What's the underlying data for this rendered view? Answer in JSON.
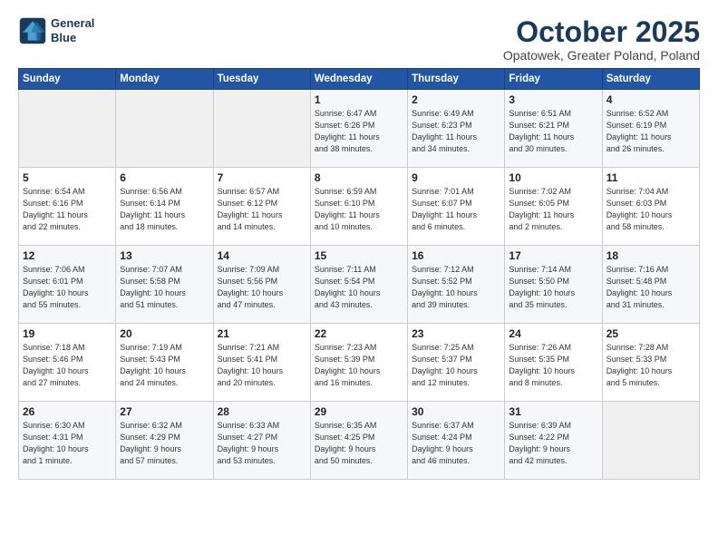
{
  "header": {
    "logo_line1": "General",
    "logo_line2": "Blue",
    "month": "October 2025",
    "location": "Opatowek, Greater Poland, Poland"
  },
  "days_of_week": [
    "Sunday",
    "Monday",
    "Tuesday",
    "Wednesday",
    "Thursday",
    "Friday",
    "Saturday"
  ],
  "weeks": [
    [
      {
        "day": "",
        "info": ""
      },
      {
        "day": "",
        "info": ""
      },
      {
        "day": "",
        "info": ""
      },
      {
        "day": "1",
        "info": "Sunrise: 6:47 AM\nSunset: 6:26 PM\nDaylight: 11 hours\nand 38 minutes."
      },
      {
        "day": "2",
        "info": "Sunrise: 6:49 AM\nSunset: 6:23 PM\nDaylight: 11 hours\nand 34 minutes."
      },
      {
        "day": "3",
        "info": "Sunrise: 6:51 AM\nSunset: 6:21 PM\nDaylight: 11 hours\nand 30 minutes."
      },
      {
        "day": "4",
        "info": "Sunrise: 6:52 AM\nSunset: 6:19 PM\nDaylight: 11 hours\nand 26 minutes."
      }
    ],
    [
      {
        "day": "5",
        "info": "Sunrise: 6:54 AM\nSunset: 6:16 PM\nDaylight: 11 hours\nand 22 minutes."
      },
      {
        "day": "6",
        "info": "Sunrise: 6:56 AM\nSunset: 6:14 PM\nDaylight: 11 hours\nand 18 minutes."
      },
      {
        "day": "7",
        "info": "Sunrise: 6:57 AM\nSunset: 6:12 PM\nDaylight: 11 hours\nand 14 minutes."
      },
      {
        "day": "8",
        "info": "Sunrise: 6:59 AM\nSunset: 6:10 PM\nDaylight: 11 hours\nand 10 minutes."
      },
      {
        "day": "9",
        "info": "Sunrise: 7:01 AM\nSunset: 6:07 PM\nDaylight: 11 hours\nand 6 minutes."
      },
      {
        "day": "10",
        "info": "Sunrise: 7:02 AM\nSunset: 6:05 PM\nDaylight: 11 hours\nand 2 minutes."
      },
      {
        "day": "11",
        "info": "Sunrise: 7:04 AM\nSunset: 6:03 PM\nDaylight: 10 hours\nand 58 minutes."
      }
    ],
    [
      {
        "day": "12",
        "info": "Sunrise: 7:06 AM\nSunset: 6:01 PM\nDaylight: 10 hours\nand 55 minutes."
      },
      {
        "day": "13",
        "info": "Sunrise: 7:07 AM\nSunset: 5:58 PM\nDaylight: 10 hours\nand 51 minutes."
      },
      {
        "day": "14",
        "info": "Sunrise: 7:09 AM\nSunset: 5:56 PM\nDaylight: 10 hours\nand 47 minutes."
      },
      {
        "day": "15",
        "info": "Sunrise: 7:11 AM\nSunset: 5:54 PM\nDaylight: 10 hours\nand 43 minutes."
      },
      {
        "day": "16",
        "info": "Sunrise: 7:12 AM\nSunset: 5:52 PM\nDaylight: 10 hours\nand 39 minutes."
      },
      {
        "day": "17",
        "info": "Sunrise: 7:14 AM\nSunset: 5:50 PM\nDaylight: 10 hours\nand 35 minutes."
      },
      {
        "day": "18",
        "info": "Sunrise: 7:16 AM\nSunset: 5:48 PM\nDaylight: 10 hours\nand 31 minutes."
      }
    ],
    [
      {
        "day": "19",
        "info": "Sunrise: 7:18 AM\nSunset: 5:46 PM\nDaylight: 10 hours\nand 27 minutes."
      },
      {
        "day": "20",
        "info": "Sunrise: 7:19 AM\nSunset: 5:43 PM\nDaylight: 10 hours\nand 24 minutes."
      },
      {
        "day": "21",
        "info": "Sunrise: 7:21 AM\nSunset: 5:41 PM\nDaylight: 10 hours\nand 20 minutes."
      },
      {
        "day": "22",
        "info": "Sunrise: 7:23 AM\nSunset: 5:39 PM\nDaylight: 10 hours\nand 16 minutes."
      },
      {
        "day": "23",
        "info": "Sunrise: 7:25 AM\nSunset: 5:37 PM\nDaylight: 10 hours\nand 12 minutes."
      },
      {
        "day": "24",
        "info": "Sunrise: 7:26 AM\nSunset: 5:35 PM\nDaylight: 10 hours\nand 8 minutes."
      },
      {
        "day": "25",
        "info": "Sunrise: 7:28 AM\nSunset: 5:33 PM\nDaylight: 10 hours\nand 5 minutes."
      }
    ],
    [
      {
        "day": "26",
        "info": "Sunrise: 6:30 AM\nSunset: 4:31 PM\nDaylight: 10 hours\nand 1 minute."
      },
      {
        "day": "27",
        "info": "Sunrise: 6:32 AM\nSunset: 4:29 PM\nDaylight: 9 hours\nand 57 minutes."
      },
      {
        "day": "28",
        "info": "Sunrise: 6:33 AM\nSunset: 4:27 PM\nDaylight: 9 hours\nand 53 minutes."
      },
      {
        "day": "29",
        "info": "Sunrise: 6:35 AM\nSunset: 4:25 PM\nDaylight: 9 hours\nand 50 minutes."
      },
      {
        "day": "30",
        "info": "Sunrise: 6:37 AM\nSunset: 4:24 PM\nDaylight: 9 hours\nand 46 minutes."
      },
      {
        "day": "31",
        "info": "Sunrise: 6:39 AM\nSunset: 4:22 PM\nDaylight: 9 hours\nand 42 minutes."
      },
      {
        "day": "",
        "info": ""
      }
    ]
  ]
}
